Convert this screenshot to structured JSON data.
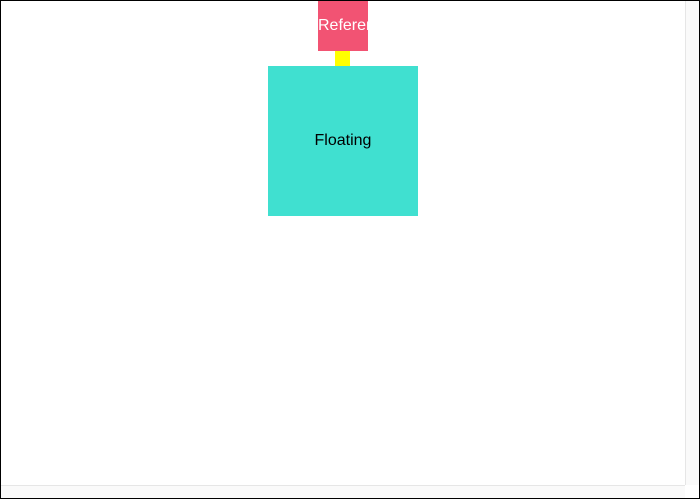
{
  "reference": {
    "label": "Reference",
    "color": "#f25373"
  },
  "floating": {
    "label": "Floating",
    "color": "#40e0d0"
  },
  "arrow": {
    "color": "#ffff00"
  }
}
